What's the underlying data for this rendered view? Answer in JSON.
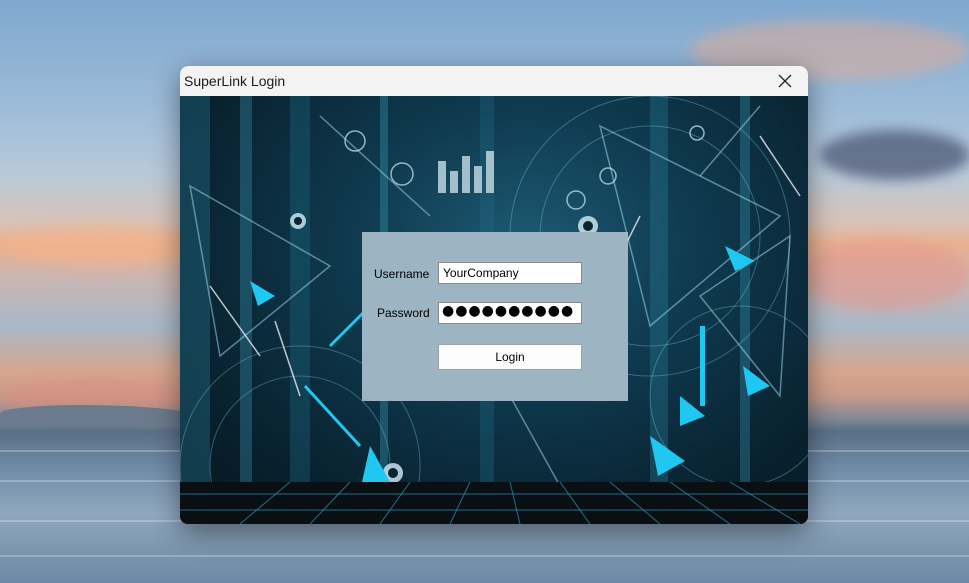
{
  "window": {
    "title": "SuperLink Login",
    "close_icon": "close-icon"
  },
  "form": {
    "username_label": "Username",
    "username_value": "YourCompany",
    "password_label": "Password",
    "password_mask": "●●●●●●●●●●",
    "login_label": "Login"
  },
  "colors": {
    "panel": "#9db5c3",
    "titlebar": "#f3f3f3",
    "accent": "#1ec8f0"
  }
}
